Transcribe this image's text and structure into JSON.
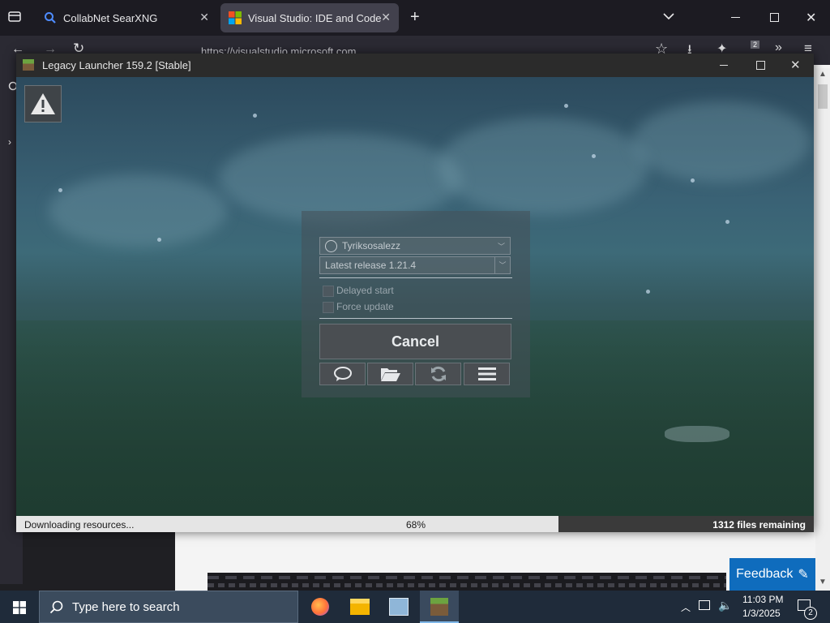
{
  "browser": {
    "tabs": [
      {
        "label": "CollabNet SearXNG",
        "active": false
      },
      {
        "label": "Visual Studio: IDE and Code Edi",
        "active": true
      }
    ],
    "url": "https://visualstudio.microsoft.com",
    "extension_badge": "2"
  },
  "launcher": {
    "title": "Legacy Launcher 159.2 [Stable]",
    "account": "Tyriksosalezz",
    "version": "Latest release 1.21.4",
    "delayed_start_label": "Delayed start",
    "force_update_label": "Force update",
    "cancel_label": "Cancel",
    "status": {
      "message": "Downloading resources...",
      "percent_label": "68%",
      "progress": 0.68,
      "remaining": "1312 files remaining"
    }
  },
  "page": {
    "feedback_label": "Feedback"
  },
  "taskbar": {
    "search_placeholder": "Type here to search",
    "time": "11:03 PM",
    "date": "1/3/2025",
    "notifications": "2"
  },
  "colors": {
    "browser_tab_bg": "#1c1b22",
    "browser_toolbar": "#2b2a33",
    "feedback": "#0f6cbd",
    "taskbar": "#1f2b3a"
  }
}
